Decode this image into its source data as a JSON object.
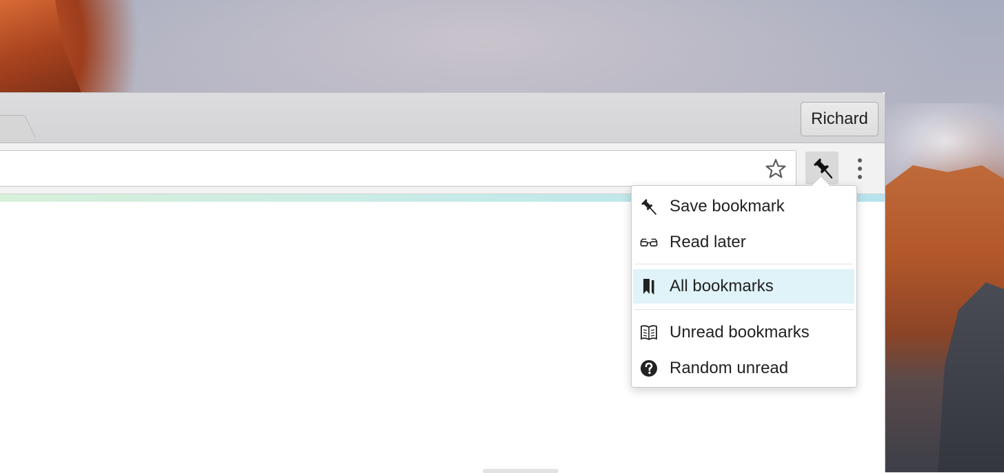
{
  "window": {
    "profile_name": "Richard"
  },
  "toolbar": {
    "address_value": ""
  },
  "bookmark_menu": {
    "items": [
      {
        "label": "Save bookmark",
        "icon": "pushpin-icon"
      },
      {
        "label": "Read later",
        "icon": "glasses-icon"
      },
      {
        "label": "All bookmarks",
        "icon": "bookmarks-icon",
        "highlighted": true
      },
      {
        "label": "Unread bookmarks",
        "icon": "open-book-icon"
      },
      {
        "label": "Random unread",
        "icon": "question-circle-icon"
      }
    ],
    "highlight_color": "#dff3f8"
  }
}
